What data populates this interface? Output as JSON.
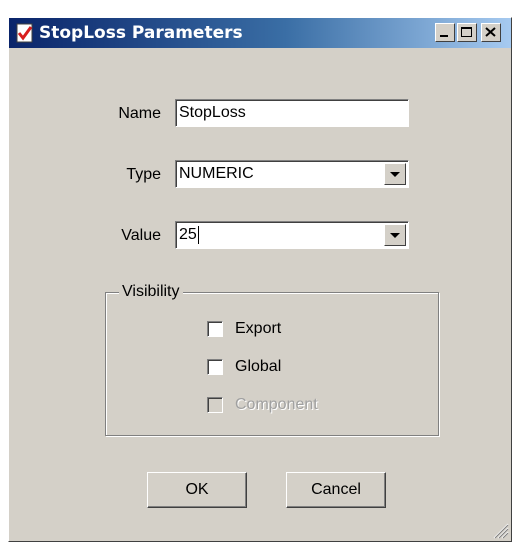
{
  "window": {
    "title": "StopLoss Parameters",
    "icon": "document-check-icon",
    "controls": [
      "minimize-icon",
      "maximize-icon",
      "close-icon"
    ]
  },
  "form": {
    "name_label": "Name",
    "name_value": "StopLoss",
    "type_label": "Type",
    "type_value": "NUMERIC",
    "value_label": "Value",
    "value_value": "25"
  },
  "visibility": {
    "legend": "Visibility",
    "options": [
      {
        "label": "Export",
        "checked": false,
        "enabled": true
      },
      {
        "label": "Global",
        "checked": false,
        "enabled": true
      },
      {
        "label": "Component",
        "checked": false,
        "enabled": false
      }
    ]
  },
  "buttons": {
    "ok": "OK",
    "cancel": "Cancel"
  },
  "colors": {
    "face": "#d4d0c8",
    "titlebar_start": "#0a246a",
    "titlebar_end": "#a6caf0",
    "disabled_text": "#a0a0a0"
  }
}
